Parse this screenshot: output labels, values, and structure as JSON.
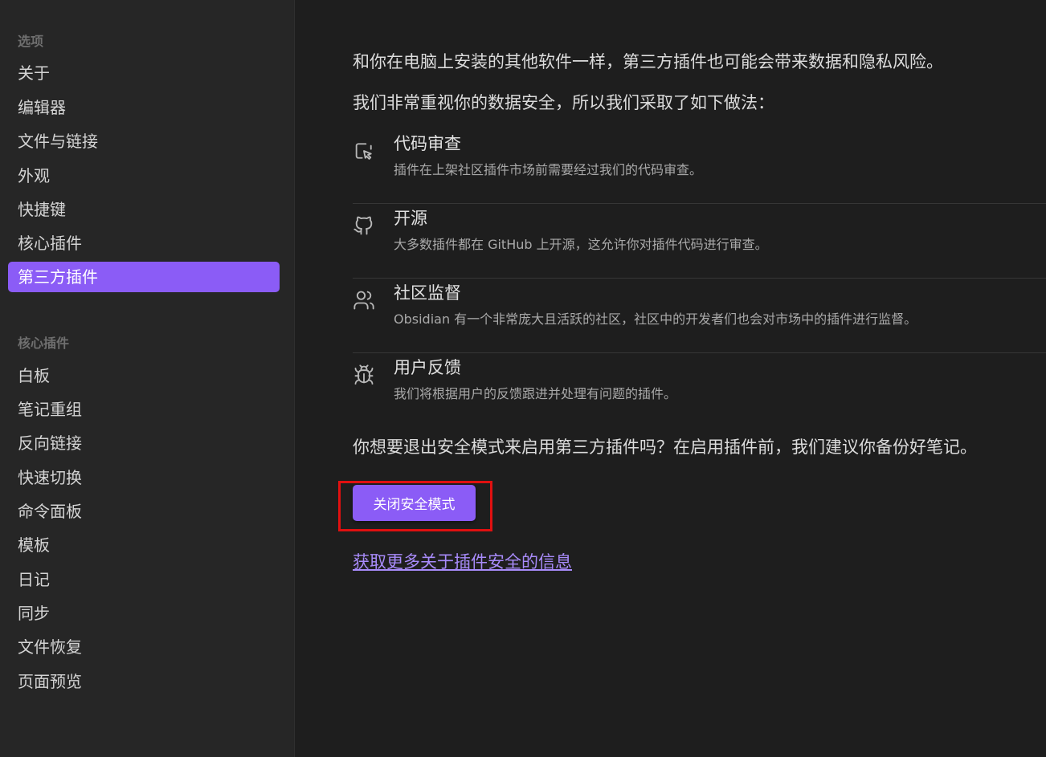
{
  "sidebar": {
    "options_title": "选项",
    "options": [
      {
        "label": "关于"
      },
      {
        "label": "编辑器"
      },
      {
        "label": "文件与链接"
      },
      {
        "label": "外观"
      },
      {
        "label": "快捷键"
      },
      {
        "label": "核心插件"
      },
      {
        "label": "第三方插件",
        "active": true
      }
    ],
    "core_plugins_title": "核心插件",
    "core_plugins": [
      {
        "label": "白板"
      },
      {
        "label": "笔记重组"
      },
      {
        "label": "反向链接"
      },
      {
        "label": "快速切换"
      },
      {
        "label": "命令面板"
      },
      {
        "label": "模板"
      },
      {
        "label": "日记"
      },
      {
        "label": "同步"
      },
      {
        "label": "文件恢复"
      },
      {
        "label": "页面预览"
      }
    ]
  },
  "main": {
    "intro_1": "和你在电脑上安装的其他软件一样，第三方插件也可能会带来数据和隐私风险。",
    "intro_2": "我们非常重视你的数据安全，所以我们采取了如下做法：",
    "features": [
      {
        "icon": "code-review-icon",
        "title": "代码审查",
        "desc": "插件在上架社区插件市场前需要经过我们的代码审查。"
      },
      {
        "icon": "github-icon",
        "title": "开源",
        "desc": "大多数插件都在 GitHub 上开源，这允许你对插件代码进行审查。"
      },
      {
        "icon": "users-icon",
        "title": "社区监督",
        "desc": "Obsidian 有一个非常庞大且活跃的社区，社区中的开发者们也会对市场中的插件进行监督。"
      },
      {
        "icon": "bug-icon",
        "title": "用户反馈",
        "desc": "我们将根据用户的反馈跟进并处理有问题的插件。"
      }
    ],
    "question": "你想要退出安全模式来启用第三方插件吗？在启用插件前，我们建议你备份好笔记。",
    "button_label": "关闭安全模式",
    "link_label": "获取更多关于插件安全的信息"
  },
  "colors": {
    "accent": "#8b5cf6",
    "link": "#a88bfa",
    "highlight": "#e01010",
    "background": "#1e1e1e",
    "sidebar_background": "#262626"
  }
}
